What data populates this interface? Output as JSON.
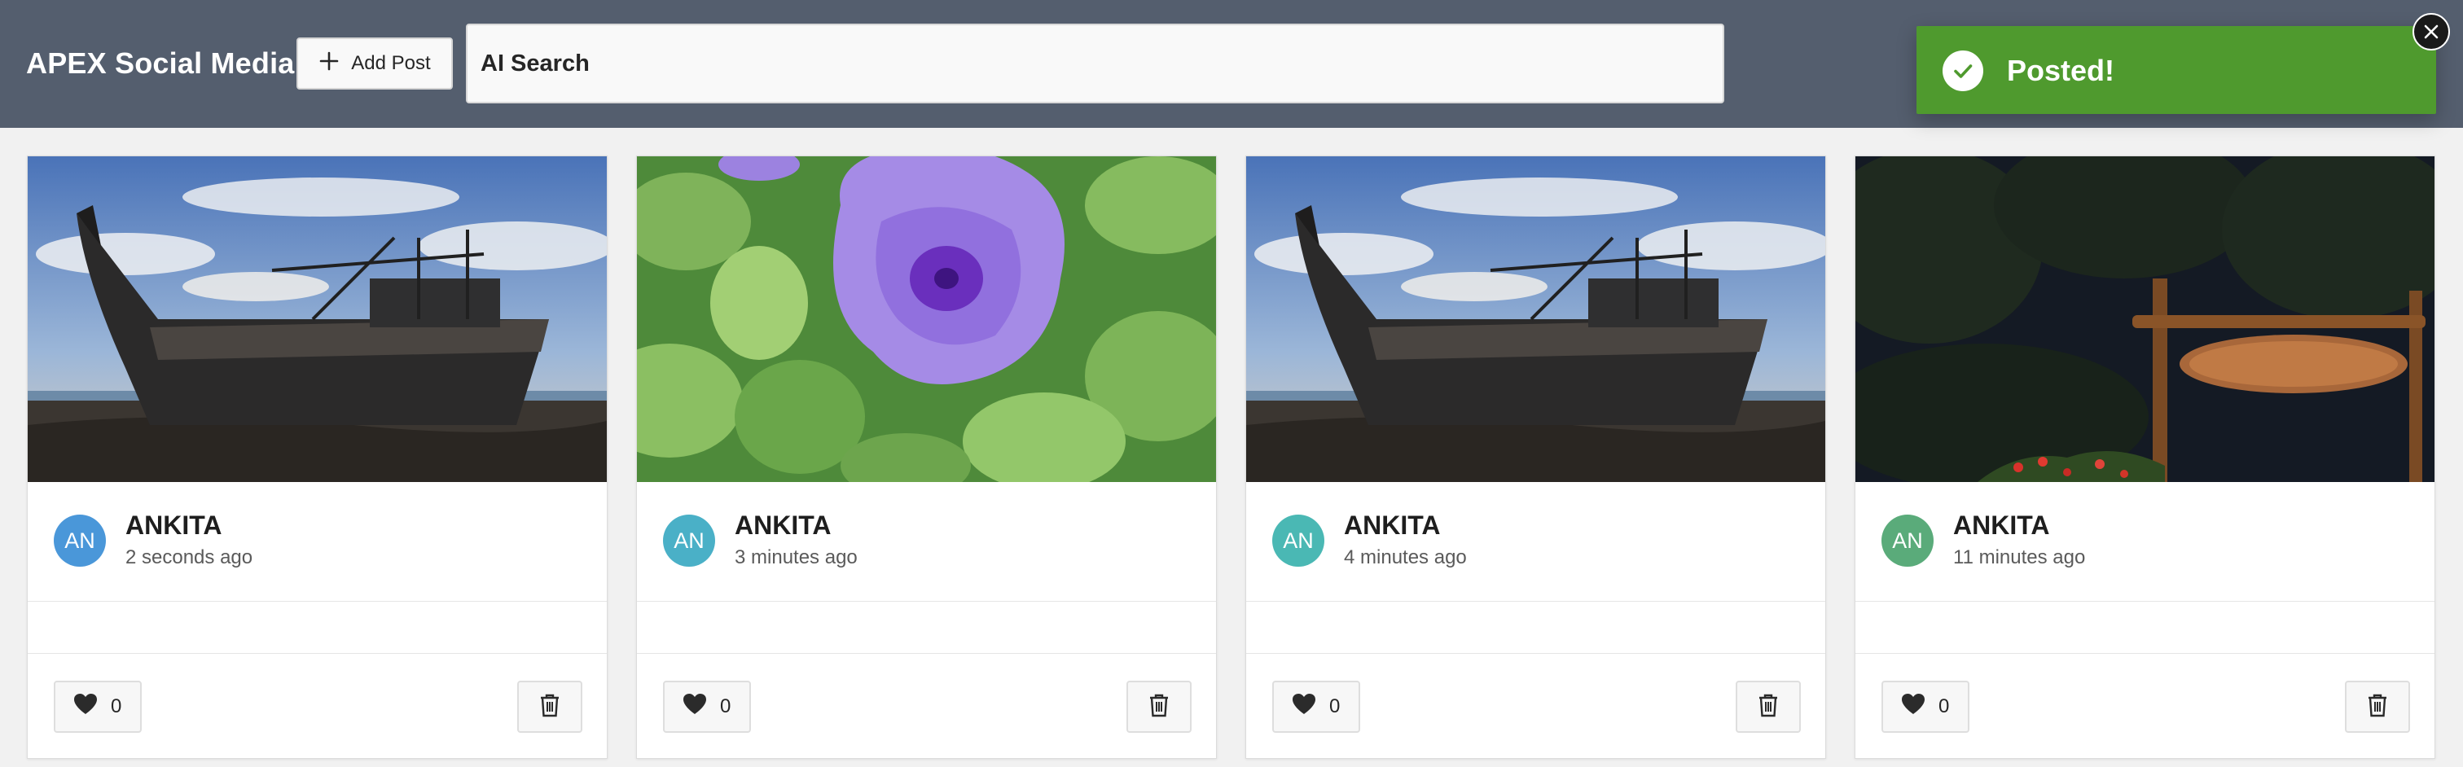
{
  "header": {
    "title": "APEX Social Media",
    "add_post_label": "Add Post",
    "search_value": "AI Search"
  },
  "toast": {
    "message": "Posted!",
    "color": "#4f9a2e"
  },
  "posts": [
    {
      "author": "ANKITA",
      "initials": "AN",
      "time": "2 seconds ago",
      "likes": "0",
      "avatar_color": "#4a97d9",
      "image": "boat on rocky beach"
    },
    {
      "author": "ANKITA",
      "initials": "AN",
      "time": "3 minutes ago",
      "likes": "0",
      "avatar_color": "#4ab0c7",
      "image": "purple flower with green leaves"
    },
    {
      "author": "ANKITA",
      "initials": "AN",
      "time": "4 minutes ago",
      "likes": "0",
      "avatar_color": "#4ab8b4",
      "image": "boat on rocky beach"
    },
    {
      "author": "ANKITA",
      "initials": "AN",
      "time": "11 minutes ago",
      "likes": "0",
      "avatar_color": "#5aab7a",
      "image": "resort sign at night"
    }
  ],
  "icons": {
    "add": "plus-icon",
    "toast": "check-icon",
    "close": "close-icon",
    "like": "heart-icon",
    "delete": "trash-icon"
  }
}
